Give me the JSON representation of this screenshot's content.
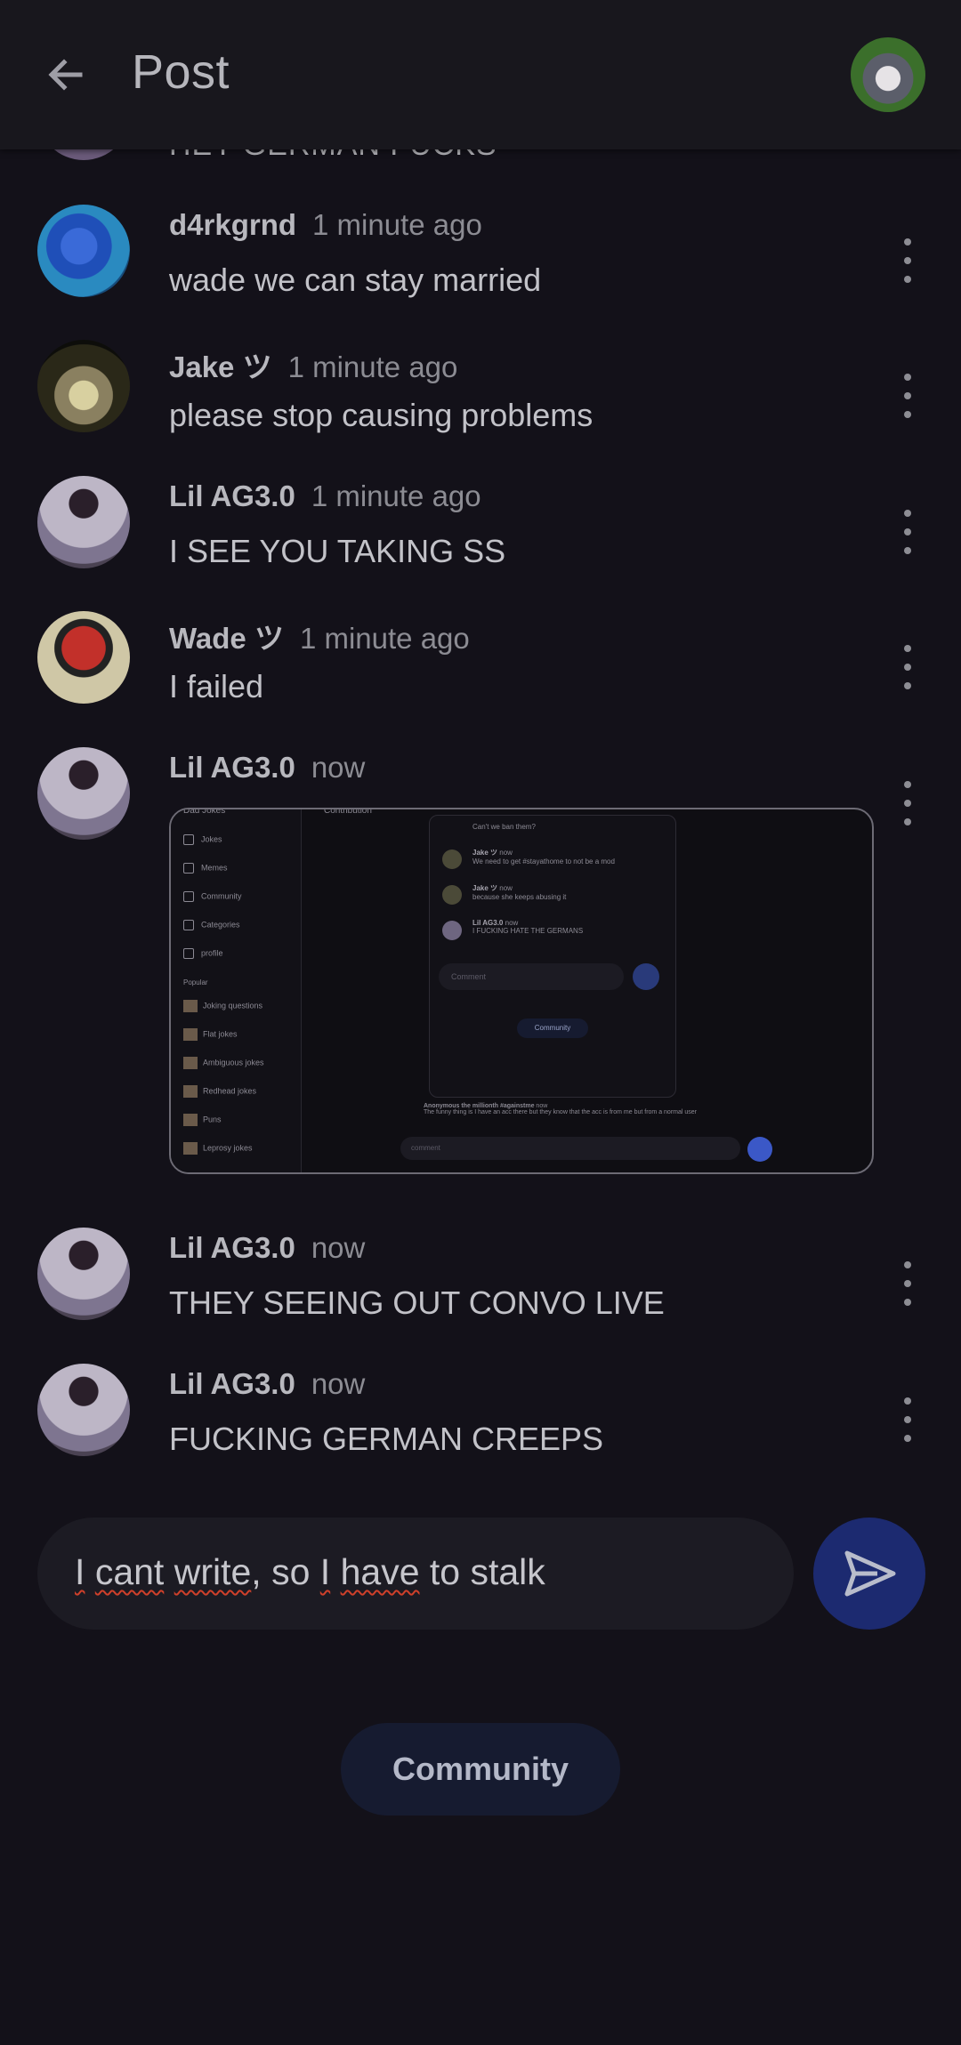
{
  "header": {
    "title": "Post",
    "back_icon": "arrow-left-icon",
    "avatar_alt": "husky-avatar"
  },
  "partial_comment": {
    "text": "HEY GERMAN FUCKS"
  },
  "comments": [
    {
      "user": "d4rkgrnd",
      "time": "1 minute ago",
      "text": "wade we can stay married"
    },
    {
      "user": "Jake ツ",
      "time": "1 minute ago",
      "text": "please stop causing problems"
    },
    {
      "user": "Lil AG3.0",
      "time": "1 minute ago",
      "text": "I SEE YOU TAKING SS"
    },
    {
      "user": "Wade ツ",
      "time": "1 minute ago",
      "text": "I failed"
    },
    {
      "user": "Lil AG3.0",
      "time": "now",
      "text": ""
    },
    {
      "user": "Lil AG3.0",
      "time": "now",
      "text": "THEY SEEING OUT CONVO LIVE"
    },
    {
      "user": "Lil AG3.0",
      "time": "now",
      "text": "FUCKING GERMAN CREEPS"
    }
  ],
  "screenshot": {
    "app_title": "Dad Jokes",
    "section_title": "Contribution",
    "sidebar": [
      "Jokes",
      "Memes",
      "Community",
      "Categories",
      "profile"
    ],
    "popular_label": "Popular",
    "popular": [
      "Joking questions",
      "Flat jokes",
      "Ambiguous jokes",
      "Redhead jokes",
      "Puns",
      "Leprosy jokes"
    ],
    "panel_comments": [
      {
        "user": "",
        "time": "",
        "text": "Can't we ban them?"
      },
      {
        "user": "Jake ツ",
        "time": "now",
        "text": "We need to get #stayathome to not be a mod"
      },
      {
        "user": "Jake ツ",
        "time": "now",
        "text": "because she keeps abusing it"
      },
      {
        "user": "Lil AG3.0",
        "time": "now",
        "text": "I FUCKING HATE THE GERMANS"
      }
    ],
    "panel_input_placeholder": "Comment",
    "panel_button": "Community",
    "anon_user": "Anonymous the millionth #againstme",
    "anon_time": "now",
    "anon_text": "The funny thing is I have an acc there but they know that the acc is from me but from a normal user",
    "bottom_placeholder": "comment"
  },
  "composer": {
    "text_parts": [
      "I",
      " ",
      "cant",
      " ",
      "write",
      ", so ",
      "I",
      " ",
      "have",
      " to stalk"
    ],
    "send_icon": "send-icon"
  },
  "community_button": "Community"
}
